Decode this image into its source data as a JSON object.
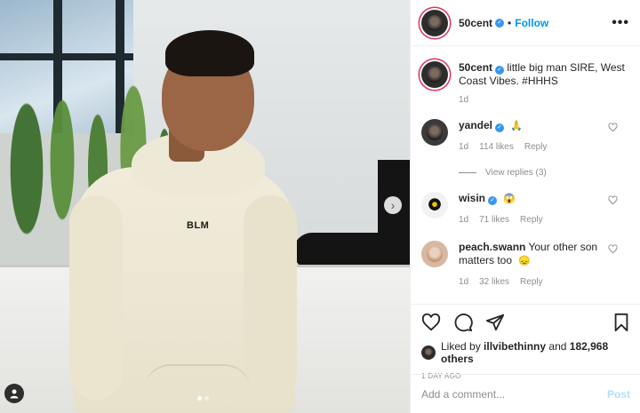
{
  "header": {
    "username": "50cent",
    "separator": "•",
    "follow_label": "Follow",
    "more_label": "•••"
  },
  "caption": {
    "username": "50cent",
    "text": "little big man SIRE, West Coast Vibes. #HHHS",
    "time": "1d"
  },
  "comments": [
    {
      "username": "yandel",
      "text": "",
      "emoji": "🙏",
      "time": "1d",
      "likes": "114 likes",
      "reply": "Reply",
      "verified": true
    },
    {
      "username": "wisin",
      "text": "",
      "emoji": "😱",
      "time": "1d",
      "likes": "71 likes",
      "reply": "Reply",
      "verified": true
    },
    {
      "username": "peach.swann",
      "text": "Your other son matters too",
      "emoji": "😞",
      "time": "1d",
      "likes": "32 likes",
      "reply": "Reply",
      "verified": false
    }
  ],
  "view_replies": "View replies (3)",
  "likes": {
    "prefix": "Liked by",
    "user": "illvibethinny",
    "conjunction": "and",
    "others": "182,968 others"
  },
  "posted": "1 DAY AGO",
  "add_comment": {
    "placeholder": "Add a comment...",
    "post_label": "Post"
  },
  "photo": {
    "shirt_text": "BLM",
    "carousel_next": "›"
  },
  "colors": {
    "accent": "#0095f6",
    "verified": "#3897f0",
    "post_disabled": "#b2dffc"
  },
  "icons": [
    "heart-icon",
    "comment-icon",
    "share-icon",
    "bookmark-icon",
    "user-tag-icon",
    "chevron-right-icon"
  ]
}
